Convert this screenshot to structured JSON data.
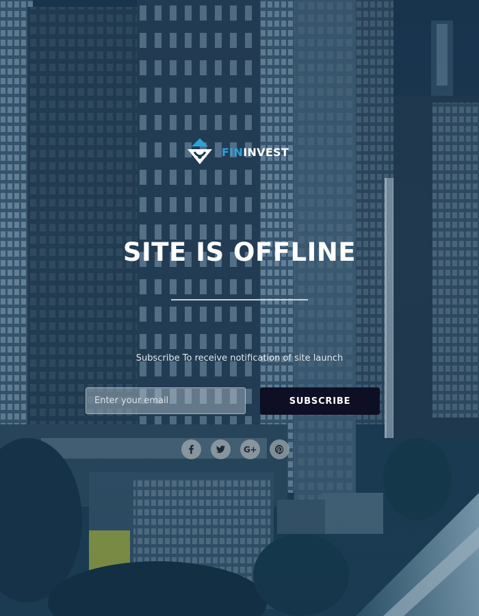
{
  "logo": {
    "prefix": "FIN",
    "suffix": "INVEST",
    "accent_color": "#29a3dc"
  },
  "heading": "SITE IS OFFLINE",
  "subtext": "Subscribe To receive notification of site launch",
  "form": {
    "email_placeholder": "Enter your email",
    "email_value": "",
    "subscribe_label": "SUBSCRIBE",
    "button_color": "#0e0f24"
  },
  "social": [
    {
      "name": "facebook",
      "icon": "facebook-icon"
    },
    {
      "name": "twitter",
      "icon": "twitter-icon"
    },
    {
      "name": "google-plus",
      "icon": "google-plus-icon",
      "glyph": "G+"
    },
    {
      "name": "pinterest",
      "icon": "pinterest-icon"
    }
  ],
  "background": {
    "description_color": "#1d3a52"
  }
}
